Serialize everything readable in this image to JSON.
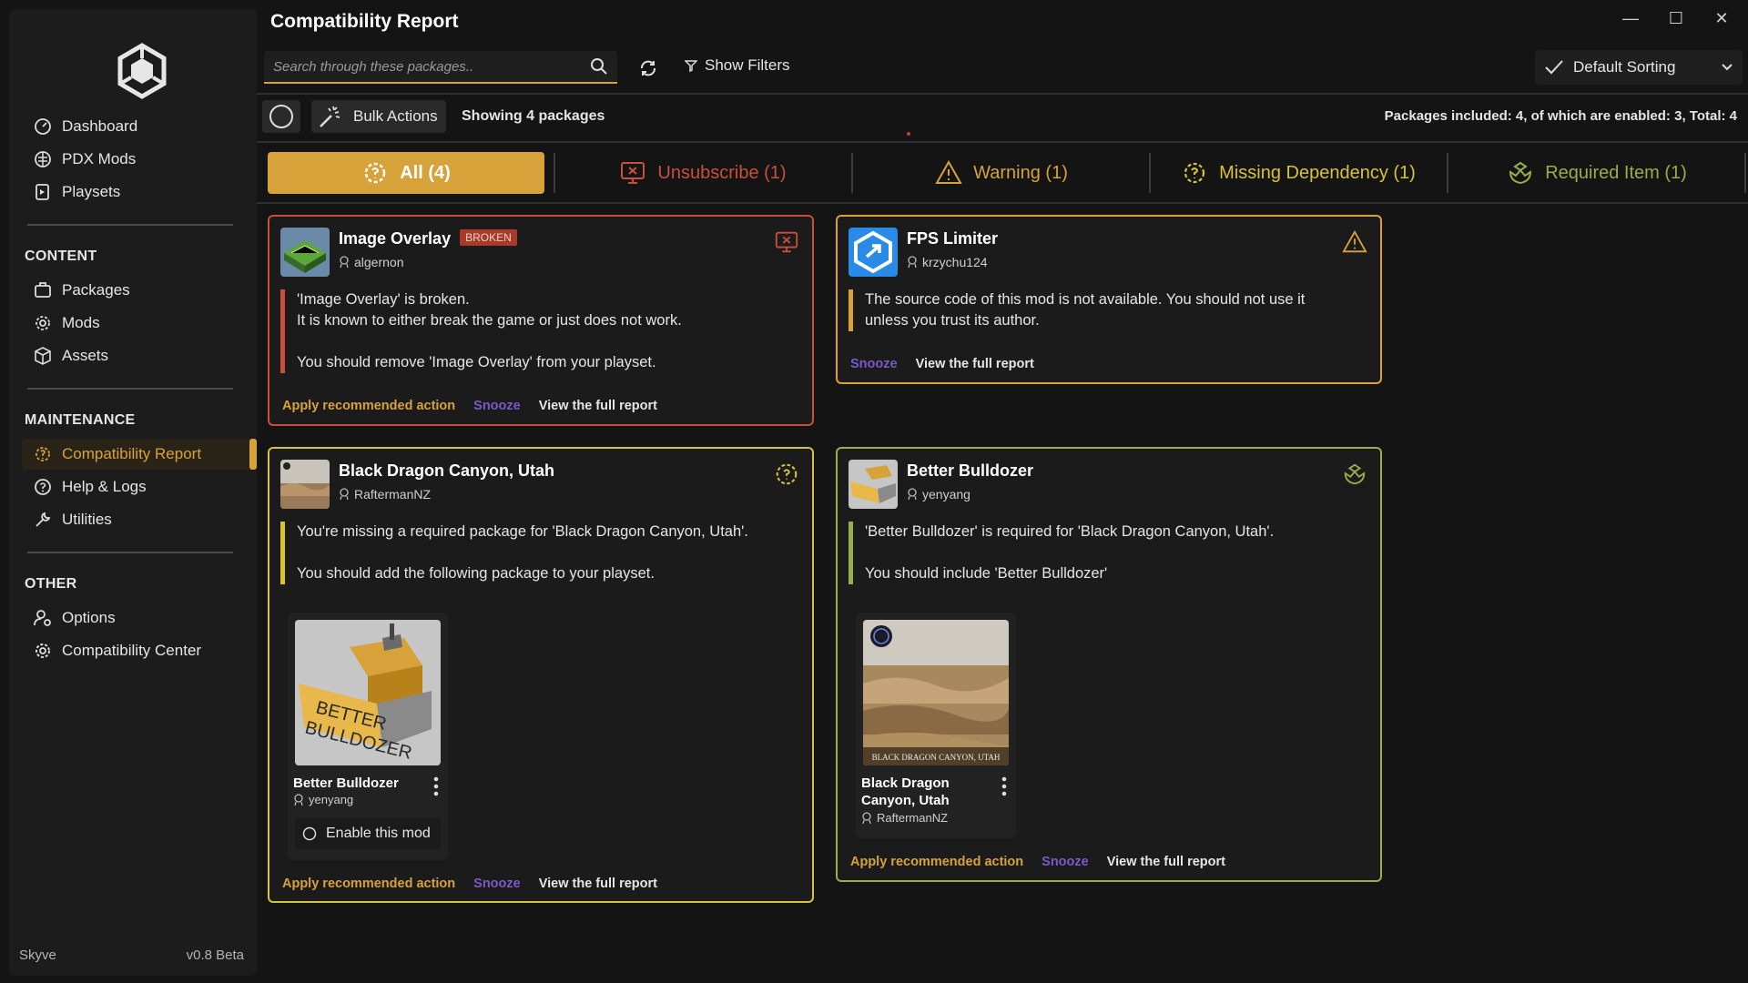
{
  "app": {
    "name": "Skyve",
    "version": "v0.8 Beta",
    "title": "Compatibility Report"
  },
  "colors": {
    "accent": "#d8a23a",
    "danger": "#c8503a",
    "warning": "#d8a23a",
    "missing": "#d8c23a",
    "required": "#9aad4a",
    "snooze": "#7a5ac8"
  },
  "sidebar": {
    "top": [
      {
        "label": "Dashboard",
        "icon": "dashboard-icon"
      },
      {
        "label": "PDX Mods",
        "icon": "pdx-icon"
      },
      {
        "label": "Playsets",
        "icon": "playsets-icon"
      }
    ],
    "content_head": "CONTENT",
    "content": [
      {
        "label": "Packages",
        "icon": "packages-icon"
      },
      {
        "label": "Mods",
        "icon": "mods-icon"
      },
      {
        "label": "Assets",
        "icon": "assets-icon"
      }
    ],
    "maintenance_head": "MAINTENANCE",
    "maintenance": [
      {
        "label": "Compatibility Report",
        "icon": "compatibility-icon"
      },
      {
        "label": "Help & Logs",
        "icon": "help-icon"
      },
      {
        "label": "Utilities",
        "icon": "utilities-icon"
      }
    ],
    "other_head": "OTHER",
    "other": [
      {
        "label": "Options",
        "icon": "options-icon"
      },
      {
        "label": "Compatibility Center",
        "icon": "gear-icon"
      }
    ]
  },
  "toolbar": {
    "search_placeholder": "Search through these packages..",
    "filters_label": "Show Filters",
    "sort_label": "Default Sorting",
    "bulk_label": "Bulk Actions",
    "showing": "Showing 4 packages",
    "included": "Packages included: 4, of which are enabled: 3, Total: 4"
  },
  "tabs": [
    {
      "label": "All (4)",
      "icon": "all-icon"
    },
    {
      "label": "Unsubscribe (1)",
      "icon": "unsubscribe-icon"
    },
    {
      "label": "Warning (1)",
      "icon": "warning-icon"
    },
    {
      "label": "Missing Dependency (1)",
      "icon": "missing-dependency-icon"
    },
    {
      "label": "Required Item (1)",
      "icon": "required-item-icon"
    }
  ],
  "cards": {
    "image_overlay": {
      "name": "Image Overlay",
      "badge": "BROKEN",
      "author": "algernon",
      "msg1": "'Image Overlay' is broken.",
      "msg2": "It is known to either break the game or just does not work.",
      "msg3": "You should remove 'Image Overlay' from your playset.",
      "apply": "Apply recommended action",
      "snooze": "Snooze",
      "report": "View the full report"
    },
    "fps_limiter": {
      "name": "FPS Limiter",
      "author": "krzychu124",
      "msg1": "The source code of this mod is not available. You should not use it",
      "msg2": "unless you trust its author.",
      "snooze": "Snooze",
      "report": "View the full report"
    },
    "black_dragon": {
      "name": "Black Dragon Canyon, Utah",
      "author": "RaftermanNZ",
      "msg1": "You're missing a required package for 'Black Dragon Canyon, Utah'.",
      "msg2": "You should add the following package to your playset.",
      "sub_name": "Better Bulldozer",
      "sub_author": "yenyang",
      "enable_label": "Enable this mod",
      "apply": "Apply recommended action",
      "snooze": "Snooze",
      "report": "View the full report"
    },
    "better_bulldozer": {
      "name": "Better Bulldozer",
      "author": "yenyang",
      "msg1": "'Better Bulldozer' is required for 'Black Dragon Canyon, Utah'.",
      "msg2": "You should include 'Better Bulldozer'",
      "sub_name": "Black Dragon Canyon, Utah",
      "sub_author": "RaftermanNZ",
      "sub_caption": "BLACK DRAGON CANYON, UTAH",
      "apply": "Apply recommended action",
      "snooze": "Snooze",
      "report": "View the full report"
    }
  },
  "thumb_text": {
    "bulldozer_line1": "BETTER",
    "bulldozer_line2": "BULLDOZER"
  }
}
